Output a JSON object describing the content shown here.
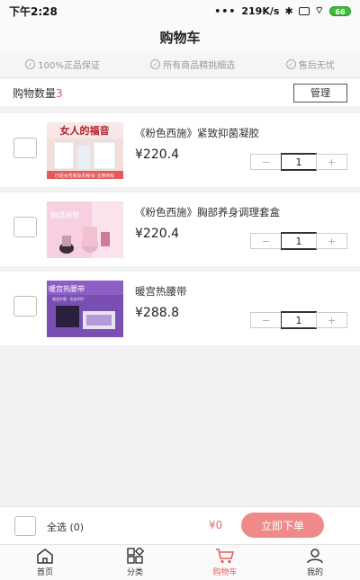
{
  "status_bar": {
    "time": "下午2:28",
    "dots": "•••",
    "network_speed": "219K/s",
    "bluetooth": "✱",
    "wifi": "⌔",
    "battery": "66"
  },
  "header": {
    "title": "购物车"
  },
  "guarantees": [
    {
      "label": "100%正品保证"
    },
    {
      "label": "所有商品精挑细选"
    },
    {
      "label": "售后无忧"
    }
  ],
  "count": {
    "label": "购物数量",
    "value": "3",
    "manage_label": "管理"
  },
  "items": [
    {
      "title": "《粉色西施》紧致抑菌凝胶",
      "price": "¥220.4",
      "quantity": "1",
      "image_text": "女人的福音",
      "image_subtext": "已经女性朋友的秘诀·注册商标"
    },
    {
      "title": "《粉色西施》胸部养身调理套盒",
      "price": "¥220.4",
      "quantity": "1",
      "image_text": "胸部调理"
    },
    {
      "title": "暖宫热腰带",
      "price": "¥288.8",
      "quantity": "1",
      "image_text": "暖宫热腰带",
      "image_subtext": "暖宫护腰 · 贴身呵护"
    }
  ],
  "stepper": {
    "minus": "−",
    "plus": "+"
  },
  "checkout": {
    "select_all_label": "全选 (0)",
    "total": "¥0",
    "order_label": "立即下单"
  },
  "tabs": [
    {
      "label": "首页",
      "icon": "home-icon"
    },
    {
      "label": "分类",
      "icon": "category-icon"
    },
    {
      "label": "购物车",
      "icon": "cart-icon",
      "active": true
    },
    {
      "label": "我的",
      "icon": "profile-icon"
    }
  ],
  "colors": {
    "accent": "#e85b5b",
    "order_button": "#f08a8a"
  }
}
